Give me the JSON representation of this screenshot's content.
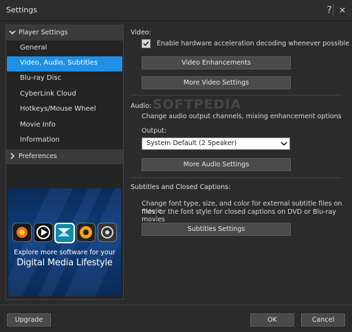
{
  "window": {
    "title": "Settings",
    "help": "?",
    "close": "✕"
  },
  "sidebar": {
    "player_settings": "Player Settings",
    "items": [
      {
        "label": "General"
      },
      {
        "label": "Video, Audio, Subtitles"
      },
      {
        "label": "Blu-ray Disc"
      },
      {
        "label": "CyberLink Cloud"
      },
      {
        "label": "Hotkeys/Mouse Wheel"
      },
      {
        "label": "Movie Info"
      },
      {
        "label": "Information"
      }
    ],
    "preferences": "Preferences",
    "active_index": 1
  },
  "promo": {
    "line1": "Explore more software for your",
    "line2": "Digital Media Lifestyle"
  },
  "video": {
    "section": "Video:",
    "hw_accel_label": "Enable hardware acceleration decoding whenever possible",
    "hw_accel_checked": true,
    "enhancements_button": "Video Enhancements",
    "more_button": "More Video Settings"
  },
  "audio": {
    "section": "Audio:",
    "description": "Change audio output channels, mixing enhancement options",
    "output_label": "Output:",
    "output_value": "System Default  (2 Speaker)",
    "more_button": "More Audio Settings"
  },
  "subtitles": {
    "section": "Subtitles and Closed Captions:",
    "description_line1": "Change font type, size, and color for external subtitle files on movie",
    "description_line2": "files, or the font style for closed captions on DVD or Blu-ray movies",
    "button": "Subtitles Settings"
  },
  "watermark": "SOFTPEDIA",
  "footer": {
    "upgrade": "Upgrade",
    "ok": "OK",
    "cancel": "Cancel"
  },
  "colors": {
    "accent": "#1e90e8",
    "background": "#2b2b2b"
  }
}
